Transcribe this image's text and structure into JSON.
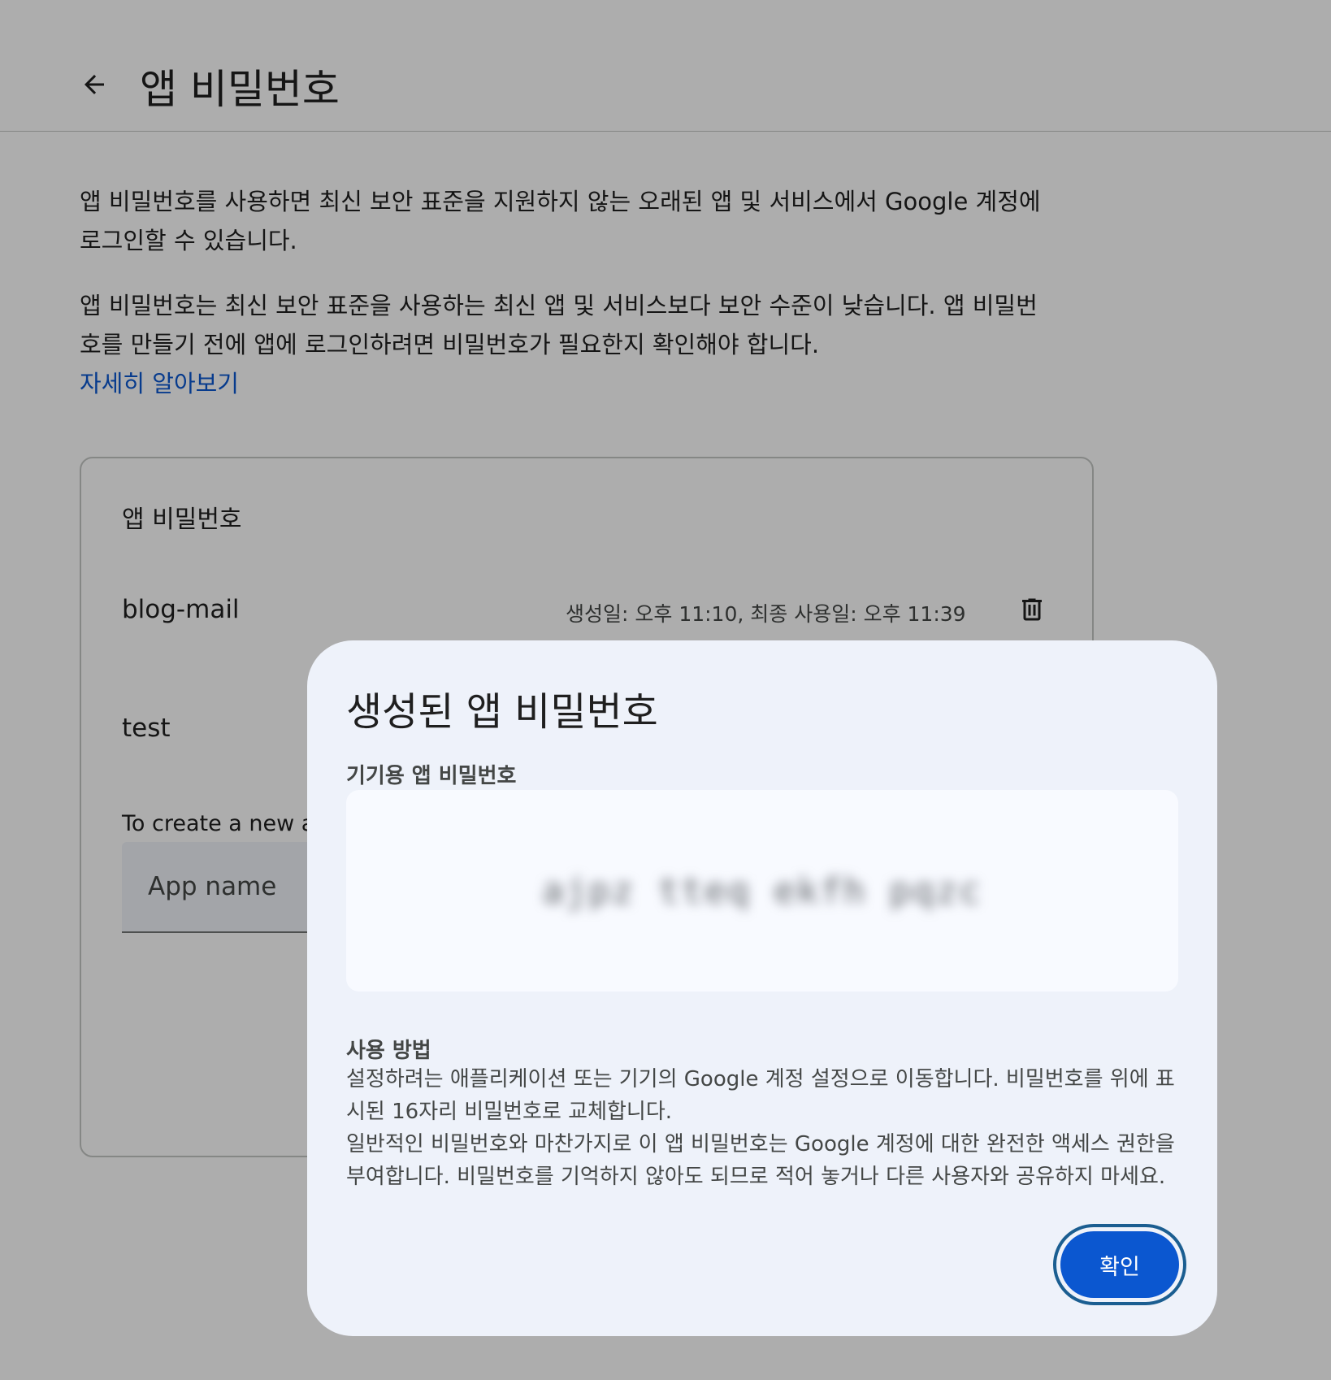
{
  "header": {
    "back_icon": "arrow-back-icon",
    "title": "앱 비밀번호"
  },
  "intro": {
    "paragraph1": "앱 비밀번호를 사용하면 최신 보안 표준을 지원하지 않는 오래된 앱 및 서비스에서 Google 계정에 로그인할 수 있습니다.",
    "paragraph2": "앱 비밀번호는 최신 보안 표준을 사용하는 최신 앱 및 서비스보다 보안 수준이 낮습니다. 앱 비밀번호를 만들기 전에 앱에 로그인하려면 비밀번호가 필요한지 확인해야 합니다.",
    "learn_more": "자세히 알아보기"
  },
  "card": {
    "title": "앱 비밀번호",
    "passwords": [
      {
        "name": "blog-mail",
        "meta": "생성일: 오후 11:10, 최종 사용일: 오후 11:39"
      },
      {
        "name": "test"
      }
    ],
    "delete_icon": "trash-icon",
    "create_hint": "To create a new ap",
    "app_name_placeholder": "App name"
  },
  "dialog": {
    "title": "생성된 앱 비밀번호",
    "password_label": "기기용 앱 비밀번호",
    "password_value": "ajpz tteq ekfh pqzc",
    "usage_title": "사용 방법",
    "usage_text1": "설정하려는 애플리케이션 또는 기기의 Google 계정 설정으로 이동합니다. 비밀번호를 위에 표시된 16자리 비밀번호로 교체합니다.",
    "usage_text2": "일반적인 비밀번호와 마찬가지로 이 앱 비밀번호는 Google 계정에 대한 완전한 액세스 권한을 부여합니다. 비밀번호를 기억하지 않아도 되므로 적어 놓거나 다른 사용자와 공유하지 마세요.",
    "confirm_label": "확인"
  },
  "colors": {
    "link": "#0b57d0",
    "primary_button": "#0b57d0",
    "dialog_bg": "#eef2fa",
    "scrim": "rgba(0,0,0,0.32)"
  }
}
